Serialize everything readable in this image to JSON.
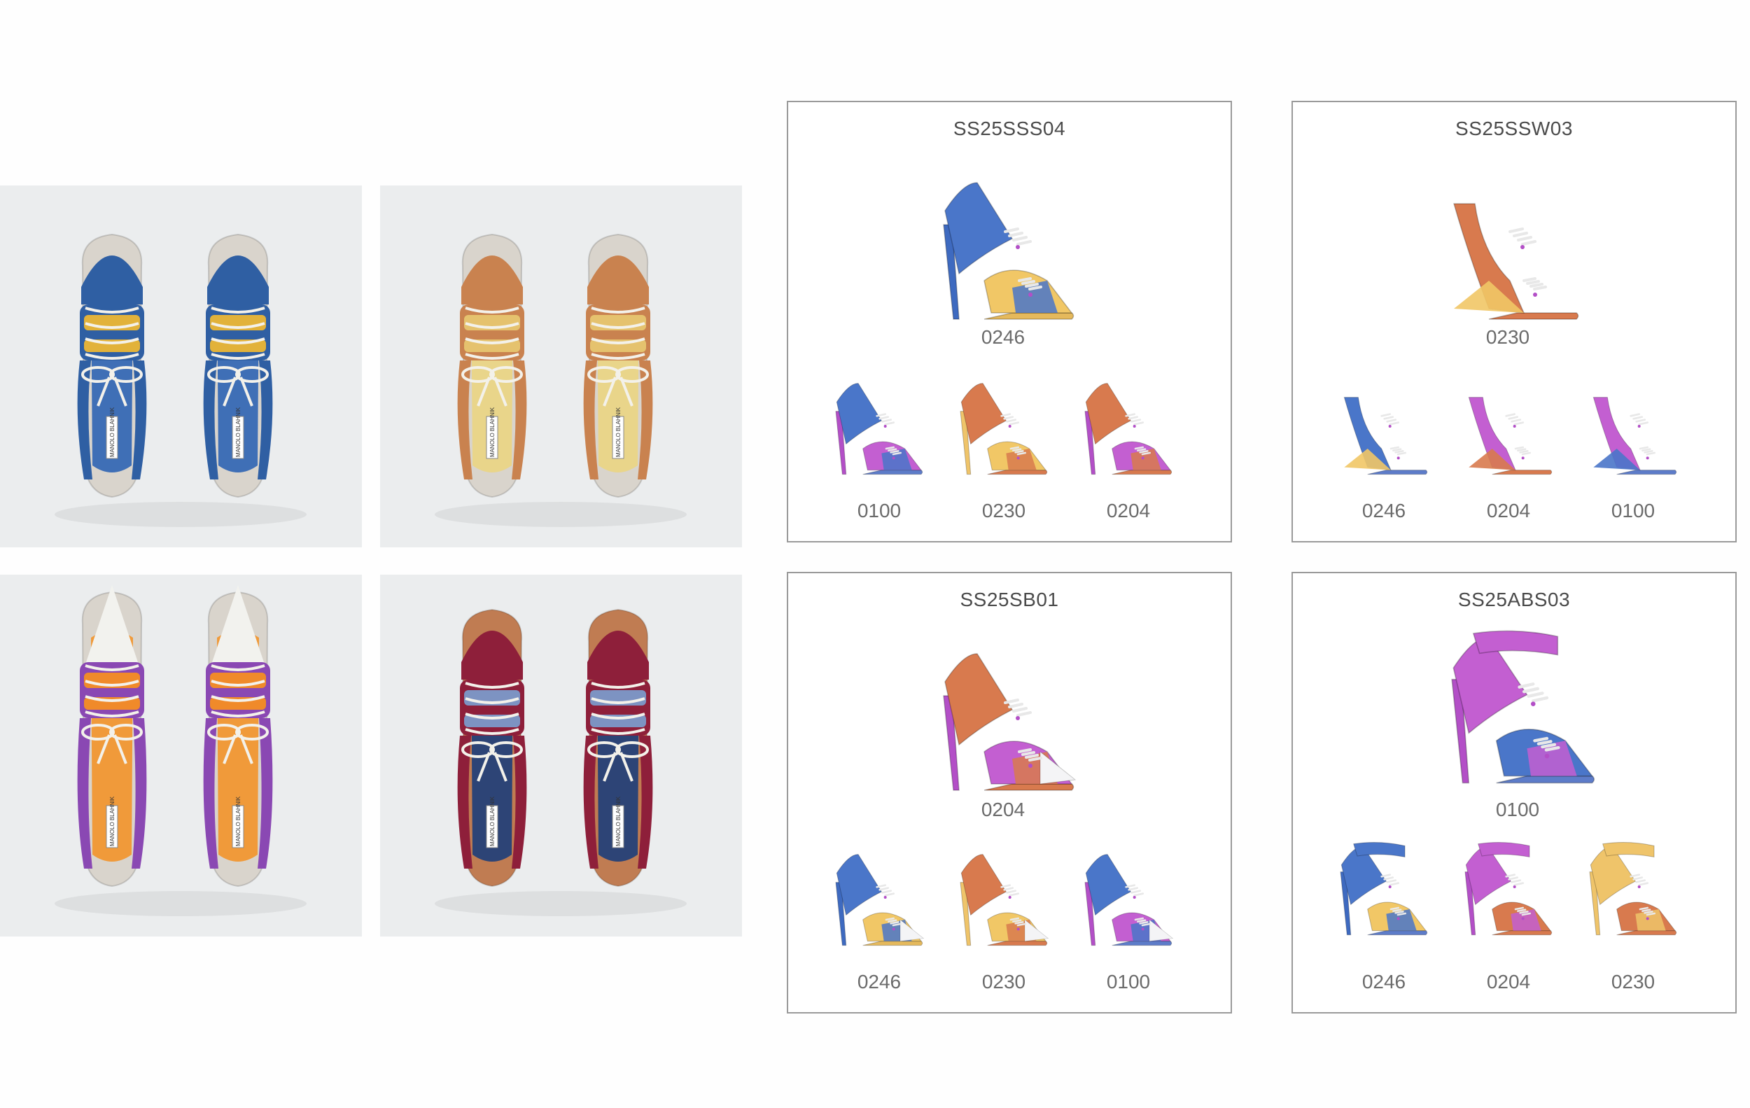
{
  "photos": [
    {
      "name": "photo-blue-yellow-sandals",
      "palette": {
        "main": "#2f5fa3",
        "accent": "#e2b23a",
        "lining": "#3f6fb6",
        "lace": "#f3f1ea"
      },
      "label": "MANOLO BLAHNIK"
    },
    {
      "name": "photo-tan-orange-sandals",
      "palette": {
        "main": "#c9824f",
        "accent": "#e5c26e",
        "lining": "#e9d58a",
        "lace": "#f3f1ea"
      },
      "label": "MANOLO BLAHNIK"
    },
    {
      "name": "photo-white-orange-purple-pumps",
      "palette": {
        "main": "#8a48b3",
        "accent": "#f08a2a",
        "lining": "#f09a3a",
        "lace": "#f3f1ea",
        "toe": "#f2f2ee"
      },
      "label": "MANOLO BLAHNIK"
    },
    {
      "name": "photo-burgundy-denim-shoes",
      "palette": {
        "main": "#8e1f3a",
        "accent": "#7d93c2",
        "lining": "#2d4476",
        "lace": "#f3f1ea",
        "sole": "#c07c52"
      },
      "label": "MANOLO BLAHNIK"
    }
  ],
  "panels": [
    {
      "title": "SS25SSS04",
      "style": "strappy",
      "main": {
        "code": "0246",
        "colors": {
          "upper": "#4a76c9",
          "accent": "#f1c766",
          "heel": "#3e6ac0",
          "sole": "#e5b95c"
        }
      },
      "variants": [
        {
          "code": "0100",
          "colors": {
            "upper": "#4a76c9",
            "accent": "#c35fd1",
            "heel": "#b34fc7",
            "sole": "#5d7cc9"
          }
        },
        {
          "code": "0230",
          "colors": {
            "upper": "#d87a4e",
            "accent": "#f1c766",
            "heel": "#efc46a",
            "sole": "#d87a4e"
          }
        },
        {
          "code": "0204",
          "colors": {
            "upper": "#d87a4e",
            "accent": "#c35fd1",
            "heel": "#b34fc7",
            "sole": "#d87a4e"
          }
        }
      ]
    },
    {
      "title": "SS25SSW03",
      "style": "wedge",
      "main": {
        "code": "0230",
        "colors": {
          "upper": "#d87a4e",
          "accent": "#f1c766",
          "heel": "#efc46a",
          "sole": "#d87a4e"
        }
      },
      "variants": [
        {
          "code": "0246",
          "colors": {
            "upper": "#4a76c9",
            "accent": "#f1c766",
            "heel": "#3e6ac0",
            "sole": "#5d7cc9"
          }
        },
        {
          "code": "0204",
          "colors": {
            "upper": "#c35fd1",
            "accent": "#d87a4e",
            "heel": "#b34fc7",
            "sole": "#d87a4e"
          }
        },
        {
          "code": "0100",
          "colors": {
            "upper": "#c35fd1",
            "accent": "#4a76c9",
            "heel": "#b34fc7",
            "sole": "#5d7cc9"
          }
        }
      ]
    },
    {
      "title": "SS25SB01",
      "style": "pump",
      "main": {
        "code": "0204",
        "colors": {
          "upper": "#d87a4e",
          "accent": "#c35fd1",
          "heel": "#b34fc7",
          "sole": "#d87a4e"
        }
      },
      "variants": [
        {
          "code": "0246",
          "colors": {
            "upper": "#4a76c9",
            "accent": "#f1c766",
            "heel": "#3e6ac0",
            "sole": "#e5b95c"
          }
        },
        {
          "code": "0230",
          "colors": {
            "upper": "#d87a4e",
            "accent": "#f1c766",
            "heel": "#efc46a",
            "sole": "#d87a4e"
          }
        },
        {
          "code": "0100",
          "colors": {
            "upper": "#4a76c9",
            "accent": "#c35fd1",
            "heel": "#b34fc7",
            "sole": "#5d7cc9"
          }
        }
      ]
    },
    {
      "title": "SS25ABS03",
      "style": "ankle",
      "main": {
        "code": "0100",
        "colors": {
          "upper": "#c35fd1",
          "accent": "#4a76c9",
          "heel": "#b34fc7",
          "sole": "#5d7cc9"
        }
      },
      "variants": [
        {
          "code": "0246",
          "colors": {
            "upper": "#4a76c9",
            "accent": "#f1c766",
            "heel": "#3e6ac0",
            "sole": "#5d7cc9"
          }
        },
        {
          "code": "0204",
          "colors": {
            "upper": "#c35fd1",
            "accent": "#d87a4e",
            "heel": "#b34fc7",
            "sole": "#d87a4e"
          }
        },
        {
          "code": "0230",
          "colors": {
            "upper": "#efc46a",
            "accent": "#d87a4e",
            "heel": "#efc46a",
            "sole": "#d87a4e"
          }
        }
      ]
    }
  ]
}
